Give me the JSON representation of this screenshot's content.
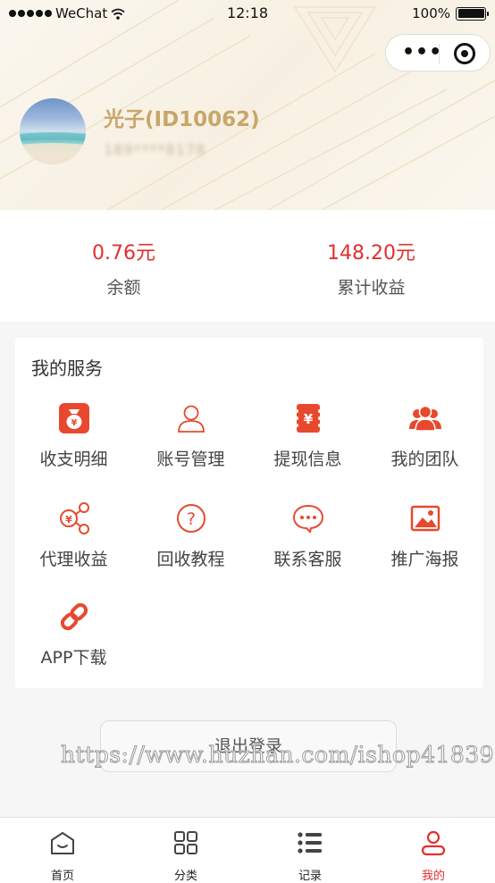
{
  "status_bar": {
    "carrier": "WeChat",
    "time": "12:18",
    "battery": "100%",
    "battery_level": 1.0
  },
  "capsule": {
    "more_icon": "more-dots-icon",
    "close_icon": "target-circle-icon"
  },
  "profile": {
    "name": "光子(ID10062)",
    "phone": "189****8178",
    "avatar_icon": "beach-avatar"
  },
  "stats": [
    {
      "value": "0.76元",
      "label": "余额"
    },
    {
      "value": "148.20元",
      "label": "累计收益"
    }
  ],
  "services": {
    "title": "我的服务",
    "items": [
      {
        "label": "收支明细",
        "icon": "money-bag-icon"
      },
      {
        "label": "账号管理",
        "icon": "user-icon"
      },
      {
        "label": "提现信息",
        "icon": "yen-card-icon"
      },
      {
        "label": "我的团队",
        "icon": "team-icon"
      },
      {
        "label": "代理收益",
        "icon": "share-yen-icon"
      },
      {
        "label": "回收教程",
        "icon": "question-icon"
      },
      {
        "label": "联系客服",
        "icon": "chat-icon"
      },
      {
        "label": "推广海报",
        "icon": "image-icon"
      },
      {
        "label": "APP下载",
        "icon": "link-icon"
      }
    ]
  },
  "logout": {
    "label": "退出登录"
  },
  "watermark": "https://www.huzhan.com/ishop41839",
  "tabbar": [
    {
      "label": "首页",
      "icon": "home-icon",
      "active": false
    },
    {
      "label": "分类",
      "icon": "grid-icon",
      "active": false
    },
    {
      "label": "记录",
      "icon": "list-icon",
      "active": false
    },
    {
      "label": "我的",
      "icon": "profile-icon",
      "active": true
    }
  ],
  "colors": {
    "accent": "#e0302e",
    "gold": "#c8a66a",
    "icon_red": "#e8492e"
  }
}
